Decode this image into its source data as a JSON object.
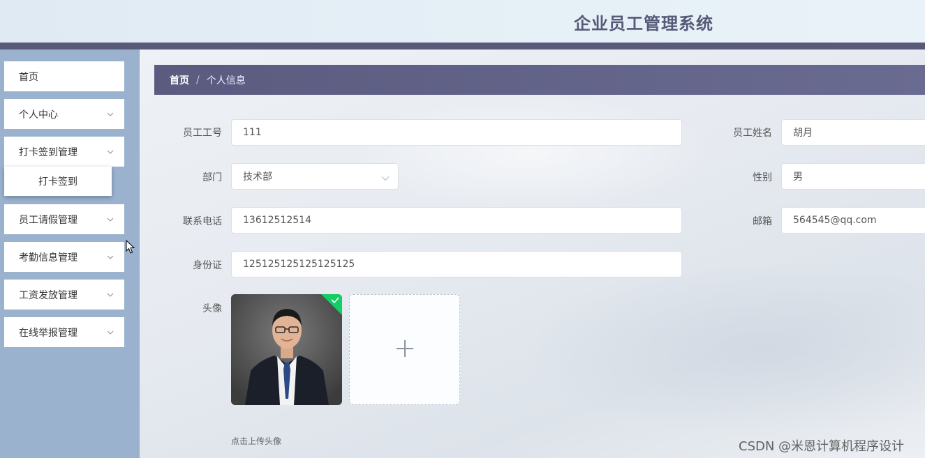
{
  "header": {
    "title": "企业员工管理系统"
  },
  "sidebar": {
    "items": [
      {
        "label": "首页"
      },
      {
        "label": "个人中心"
      },
      {
        "label": "打卡签到管理"
      },
      {
        "label": "员工请假管理"
      },
      {
        "label": "考勤信息管理"
      },
      {
        "label": "工资发放管理"
      },
      {
        "label": "在线举报管理"
      }
    ],
    "submenu": {
      "label": "打卡签到"
    }
  },
  "breadcrumb": {
    "home": "首页",
    "separator": "/",
    "current": "个人信息"
  },
  "form": {
    "employee_no": {
      "label": "员工工号",
      "value": "111"
    },
    "employee_name": {
      "label": "员工姓名",
      "value": "胡月"
    },
    "department": {
      "label": "部门",
      "value": "技术部"
    },
    "gender": {
      "label": "性别",
      "value": "男"
    },
    "phone": {
      "label": "联系电话",
      "value": "13612512514"
    },
    "email": {
      "label": "邮箱",
      "value": "564545@qq.com"
    },
    "id_card": {
      "label": "身份证",
      "value": "125125125125125125"
    },
    "avatar": {
      "label": "头像",
      "hint": "点击上传头像"
    }
  },
  "watermark": "CSDN @米恩计算机程序设计",
  "colors": {
    "header_bar": "#59597a",
    "sidebar_bg": "#9ab2ce",
    "breadcrumb_bg": "#5b5b80",
    "success_badge": "#13ce66"
  }
}
